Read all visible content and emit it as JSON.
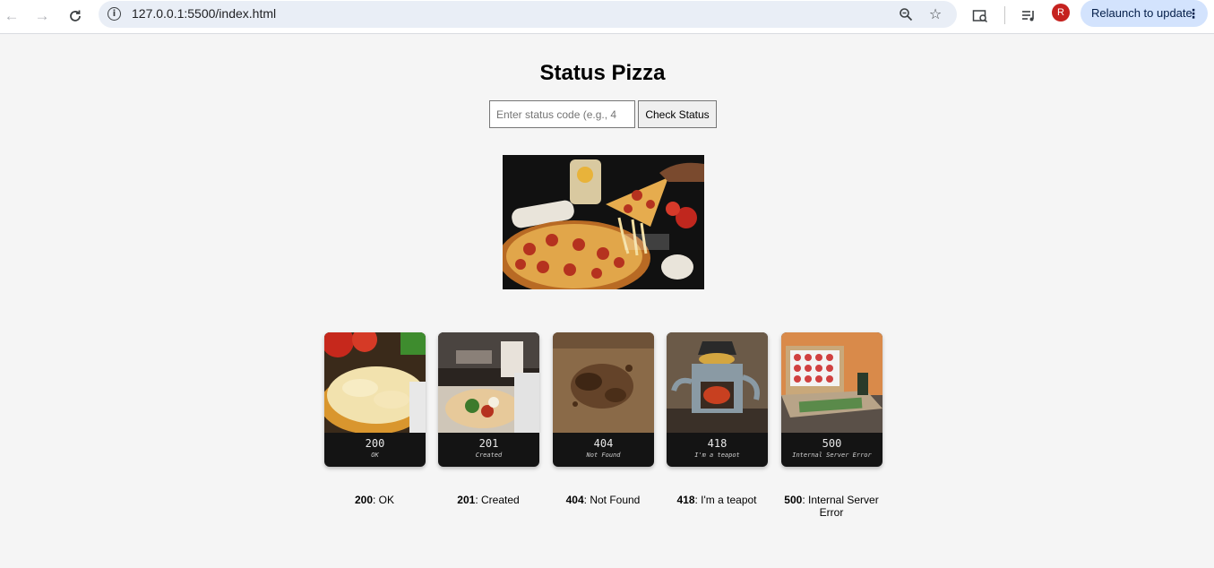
{
  "browser": {
    "url": "127.0.0.1:5500/index.html",
    "relaunch_label": "Relaunch to update",
    "avatar_initial": "R"
  },
  "page": {
    "title": "Status Pizza",
    "input_placeholder": "Enter status code (e.g., 4",
    "check_button": "Check Status"
  },
  "cards": [
    {
      "code": "200",
      "message": "OK"
    },
    {
      "code": "201",
      "message": "Created"
    },
    {
      "code": "404",
      "message": "Not Found"
    },
    {
      "code": "418",
      "message": "I'm a teapot"
    },
    {
      "code": "500",
      "message": "Internal Server Error"
    }
  ],
  "captions": [
    {
      "code": "200",
      "text": ": OK"
    },
    {
      "code": "201",
      "text": ": Created"
    },
    {
      "code": "404",
      "text": ": Not Found"
    },
    {
      "code": "418",
      "text": ": I'm a teapot"
    },
    {
      "code": "500",
      "text": ": Internal Server Error"
    }
  ]
}
